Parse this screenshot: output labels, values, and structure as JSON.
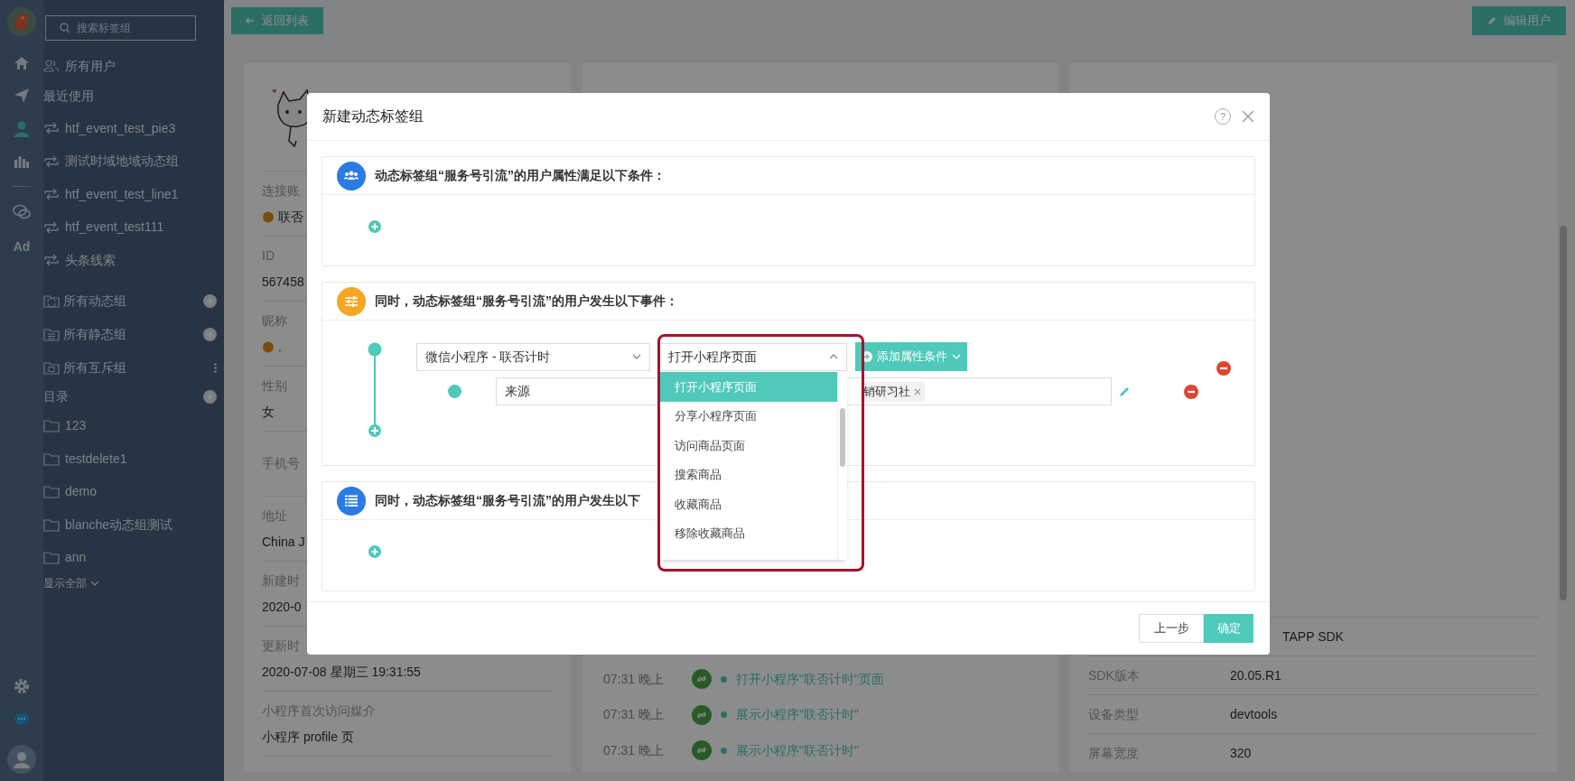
{
  "icon_rail": {
    "items": [
      {
        "kind": "home",
        "selected": false
      },
      {
        "kind": "send",
        "selected": false
      },
      {
        "kind": "user",
        "selected": true
      },
      {
        "kind": "chart",
        "selected": false
      },
      {
        "kind": "chat",
        "selected": false
      },
      {
        "kind": "text",
        "label": "Ad",
        "selected": false
      }
    ],
    "bottom": [
      {
        "kind": "gear"
      },
      {
        "kind": "message"
      },
      {
        "kind": "avatar"
      }
    ]
  },
  "sidebar": {
    "search": {
      "placeholder": "搜索标签组"
    },
    "all_users": "所有用户",
    "recent_heading": "最近使用",
    "recent": [
      "htf_event_test_pie3",
      "测试时域地域动态组",
      "htf_event_test_line1",
      "htf_event_test111",
      "头条线索"
    ],
    "groups": [
      {
        "label": "所有动态组",
        "kind": "add"
      },
      {
        "label": "所有静态组",
        "kind": "add"
      },
      {
        "label": "所有互斥组",
        "kind": "more"
      }
    ],
    "directory": {
      "heading": "目录",
      "folders": [
        "123",
        "testdelete1",
        "demo",
        "blanche动态组测试",
        "ann"
      ],
      "show_all": "显示全部"
    }
  },
  "toolbar": {
    "back_button": "返回列表",
    "edit_button": "编辑用户"
  },
  "profile_card": {
    "fields": [
      {
        "label": "连接账",
        "value": "联否"
      },
      {
        "label": "ID",
        "value": "567458"
      },
      {
        "label": "昵称",
        "value": "."
      },
      {
        "label": "性别",
        "value": "女"
      },
      {
        "label": "手机号"
      },
      {
        "label": "地址",
        "value": "China J"
      },
      {
        "label": "新建时",
        "value": "2020-0"
      },
      {
        "label": "更新时",
        "value": "2020-07-08 星期三 19:31:55"
      },
      {
        "label": "小程序首次访问媒介",
        "value": "小程序 profile 页"
      }
    ]
  },
  "timeline": [
    {
      "time": "07:31 晚上",
      "event": "打开小程序\"联否计时\"页面"
    },
    {
      "time": "07:31 晚上",
      "event": "展示小程序\"联否计时\""
    },
    {
      "time": "07:31 晚上",
      "event": "展示小程序\"联否计时\""
    }
  ],
  "device_info": [
    {
      "value": "TAPP SDK"
    },
    {
      "label": "SDK版本",
      "value": "20.05.R1"
    },
    {
      "label": "设备类型",
      "value": "devtools"
    },
    {
      "label": "屏幕宽度",
      "value": "320"
    }
  ],
  "modal": {
    "title": "新建动态标签组",
    "help": "?",
    "sections": [
      {
        "kind": "people",
        "title": "动态标签组“服务号引流”的用户属性满足以下条件："
      },
      {
        "kind": "events",
        "title": "同时，动态标签组“服务号引流”的用户发生以下事件：",
        "event": {
          "source": "微信小程序 - 联否计时",
          "action": "打开小程序页面",
          "add_button": "添加属性条件",
          "condition": {
            "property": "来源",
            "tag": "销研习社"
          }
        }
      },
      {
        "kind": "list",
        "title": "同时，动态标签组“服务号引流”的用户发生以下"
      }
    ],
    "dropdown": {
      "options": [
        {
          "label": "打开小程序页面",
          "selected": true
        },
        {
          "label": "分享小程序页面",
          "selected": false
        },
        {
          "label": "访问商品页面",
          "selected": false
        },
        {
          "label": "搜索商品",
          "selected": false
        },
        {
          "label": "收藏商品",
          "selected": false
        },
        {
          "label": "移除收藏商品",
          "selected": false
        }
      ]
    },
    "buttons": {
      "back": "上一步",
      "confirm": "确定"
    }
  }
}
